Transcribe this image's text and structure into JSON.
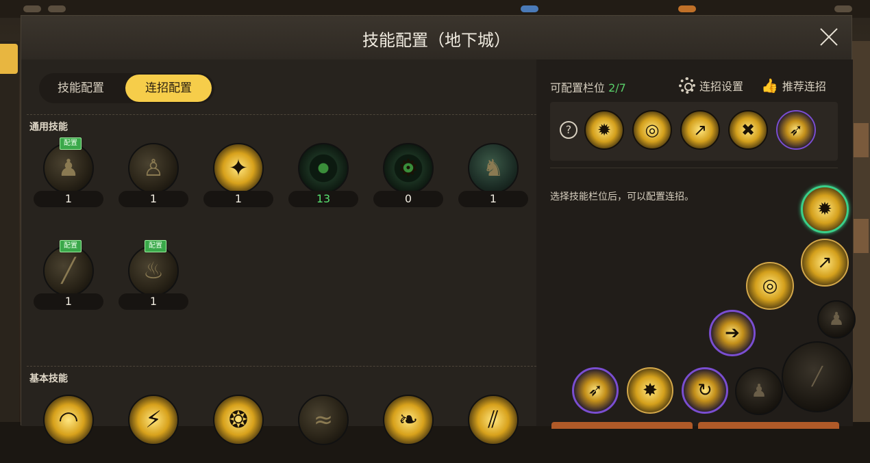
{
  "dialog": {
    "title": "技能配置（地下城）",
    "close_label": "close"
  },
  "tabs": {
    "skill_config": "技能配置",
    "combo_config": "连招配置",
    "active": "combo_config"
  },
  "sections": {
    "general": "通用技能",
    "basic": "基本技能"
  },
  "badge_label": "配置",
  "general_skills": [
    {
      "icon": "sitting-figure-icon",
      "count": "1",
      "configured": true,
      "style": "dim"
    },
    {
      "icon": "crouch-figure-icon",
      "count": "1",
      "configured": false,
      "style": "dim"
    },
    {
      "icon": "dash-strike-icon",
      "count": "1",
      "configured": false,
      "style": "gold"
    },
    {
      "icon": "target-icon",
      "count": "13",
      "configured": false,
      "style": "target",
      "highlight": "#58e070"
    },
    {
      "icon": "target-gear-icon",
      "count": "0",
      "configured": false,
      "style": "target"
    },
    {
      "icon": "fighter-icon",
      "count": "1",
      "configured": false,
      "style": "teal"
    },
    {
      "icon": "claw-slash-icon",
      "count": "1",
      "configured": true,
      "style": "dim"
    },
    {
      "icon": "flame-pose-icon",
      "count": "1",
      "configured": true,
      "style": "dim"
    }
  ],
  "basic_skills": [
    {
      "icon": "arc-slash-icon"
    },
    {
      "icon": "lightning-burst-icon"
    },
    {
      "icon": "crown-burst-icon"
    },
    {
      "icon": "dark-wave-icon"
    },
    {
      "icon": "branch-strike-icon"
    },
    {
      "icon": "triple-claw-icon"
    }
  ],
  "right": {
    "slots_label": "可配置栏位",
    "slots_value": "2/7",
    "combo_settings": "连招设置",
    "recommend": "推荐连招",
    "hint": "选择技能栏位后，可以配置连招。"
  },
  "combo_slots": [
    {
      "icon": "kick-burst-icon",
      "style": "gold"
    },
    {
      "icon": "spin-disc-icon",
      "style": "gold"
    },
    {
      "icon": "rising-slash-icon",
      "style": "gold"
    },
    {
      "icon": "cross-slash-icon",
      "style": "gold"
    },
    {
      "icon": "swift-slash-icon",
      "style": "purple"
    }
  ],
  "wheel_skills": [
    {
      "icon": "kick-burst-icon",
      "style": "gold",
      "selected": true
    },
    {
      "icon": "rising-slash-icon",
      "style": "gold"
    },
    {
      "icon": "spin-disc-icon",
      "style": "gold"
    },
    {
      "icon": "shadow-figure-icon",
      "style": "dark"
    },
    {
      "icon": "charge-slash-icon",
      "style": "purple"
    },
    {
      "icon": "large-claw-icon",
      "style": "dark"
    },
    {
      "icon": "swift-slash-icon",
      "style": "purple"
    },
    {
      "icon": "cannon-blast-icon",
      "style": "gold"
    },
    {
      "icon": "whirl-dash-icon",
      "style": "purple"
    },
    {
      "icon": "sitting-figure-icon",
      "style": "dark"
    }
  ],
  "colors": {
    "accent_tab": "#f6cd4a",
    "badge": "#3aa84a",
    "highlight_green": "#58e070",
    "selected_ring": "#3ad08a",
    "purple_ring": "#7a4ed0"
  }
}
